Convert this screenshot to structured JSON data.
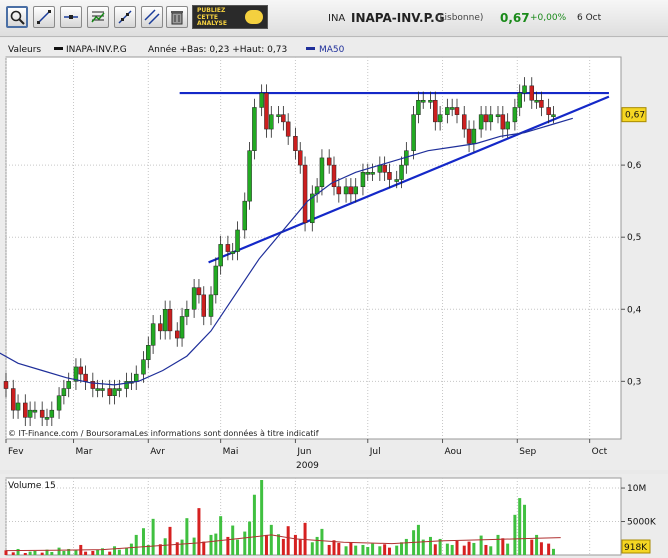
{
  "header": {
    "ad": {
      "lines": [
        "PUBLIEZ",
        "CETTE",
        "ANALYSE"
      ]
    },
    "symbol_code": "INA",
    "symbol_name": "INAPA-INV.P.G",
    "market": "(Lisbonne)",
    "price": "0,67",
    "change": "+0,00%",
    "date": "6 Oct",
    "tools": [
      "zoom-icon",
      "draw-line-icon",
      "horizontal-line-icon",
      "indicator-icon",
      "trend-line-icon",
      "parallel-lines-icon",
      "trash-icon"
    ]
  },
  "colors": {
    "up": "#22aa22",
    "down": "#cc1f1f",
    "ma": "#1f2f9a",
    "trendline": "#1428c8",
    "grid": "#c6c6c6",
    "price_label_bg": "#f5d623",
    "vol_up": "#40c040",
    "vol_down": "#d62020",
    "vol_ma": "#b03030"
  },
  "chart_data": [
    {
      "type": "candlestick",
      "legend": {
        "series_label": "Valeurs",
        "symbol": "INAPA-INV.P.G",
        "year_range": "Année +Bas: 0,23 +Haut: 0,73",
        "ma_label": "MA50"
      },
      "ylim": [
        0.22,
        0.75
      ],
      "yticks": [
        {
          "v": 0.3,
          "label": "0,3"
        },
        {
          "v": 0.4,
          "label": "0,4"
        },
        {
          "v": 0.5,
          "label": "0,5"
        },
        {
          "v": 0.6,
          "label": "0,6"
        }
      ],
      "x_months": [
        {
          "label": "Fev",
          "day": 0
        },
        {
          "label": "Mar",
          "day": 28
        },
        {
          "label": "Avr",
          "day": 59
        },
        {
          "label": "Mai",
          "day": 89
        },
        {
          "label": "Jun",
          "day": 120
        },
        {
          "label": "Jul",
          "day": 150
        },
        {
          "label": "Aou",
          "day": 181
        },
        {
          "label": "Sep",
          "day": 212
        },
        {
          "label": "Oct",
          "day": 242
        }
      ],
      "x_day_range": [
        0,
        255
      ],
      "year_label": "2009",
      "last_price_label": "0,67",
      "last_price": 0.67,
      "source": "© IT-Finance.com / BoursoramaLes informations sont données à titre indicatif",
      "resistance_line": {
        "from": [
          72,
          0.7
        ],
        "to": [
          250,
          0.7
        ]
      },
      "support_line": {
        "from": [
          84,
          0.465
        ],
        "to": [
          250,
          0.695
        ]
      },
      "ma50": [
        [
          -3,
          0.34
        ],
        [
          5,
          0.325
        ],
        [
          15,
          0.315
        ],
        [
          25,
          0.305
        ],
        [
          35,
          0.298
        ],
        [
          45,
          0.295
        ],
        [
          55,
          0.3
        ],
        [
          65,
          0.315
        ],
        [
          75,
          0.335
        ],
        [
          85,
          0.37
        ],
        [
          95,
          0.42
        ],
        [
          105,
          0.47
        ],
        [
          115,
          0.51
        ],
        [
          125,
          0.55
        ],
        [
          135,
          0.575
        ],
        [
          145,
          0.59
        ],
        [
          155,
          0.6
        ],
        [
          165,
          0.61
        ],
        [
          175,
          0.62
        ],
        [
          185,
          0.625
        ],
        [
          195,
          0.63
        ],
        [
          205,
          0.64
        ],
        [
          215,
          0.645
        ],
        [
          225,
          0.655
        ],
        [
          235,
          0.665
        ]
      ],
      "closes": [
        [
          0,
          0.29
        ],
        [
          3,
          0.26
        ],
        [
          5,
          0.27
        ],
        [
          8,
          0.25
        ],
        [
          10,
          0.26
        ],
        [
          12,
          0.26
        ],
        [
          15,
          0.25
        ],
        [
          17,
          0.25
        ],
        [
          19,
          0.26
        ],
        [
          22,
          0.28
        ],
        [
          24,
          0.29
        ],
        [
          26,
          0.3
        ],
        [
          29,
          0.32
        ],
        [
          31,
          0.31
        ],
        [
          33,
          0.3
        ],
        [
          36,
          0.29
        ],
        [
          38,
          0.29
        ],
        [
          40,
          0.29
        ],
        [
          43,
          0.28
        ],
        [
          45,
          0.29
        ],
        [
          47,
          0.29
        ],
        [
          50,
          0.3
        ],
        [
          52,
          0.3
        ],
        [
          54,
          0.31
        ],
        [
          57,
          0.33
        ],
        [
          59,
          0.35
        ],
        [
          61,
          0.38
        ],
        [
          64,
          0.37
        ],
        [
          66,
          0.4
        ],
        [
          68,
          0.37
        ],
        [
          71,
          0.36
        ],
        [
          73,
          0.39
        ],
        [
          75,
          0.4
        ],
        [
          78,
          0.43
        ],
        [
          80,
          0.42
        ],
        [
          82,
          0.39
        ],
        [
          85,
          0.42
        ],
        [
          87,
          0.46
        ],
        [
          89,
          0.49
        ],
        [
          92,
          0.48
        ],
        [
          94,
          0.48
        ],
        [
          96,
          0.51
        ],
        [
          99,
          0.55
        ],
        [
          101,
          0.62
        ],
        [
          103,
          0.68
        ],
        [
          106,
          0.7
        ],
        [
          108,
          0.65
        ],
        [
          110,
          0.67
        ],
        [
          113,
          0.67
        ],
        [
          115,
          0.66
        ],
        [
          117,
          0.64
        ],
        [
          120,
          0.62
        ],
        [
          122,
          0.6
        ],
        [
          124,
          0.52
        ],
        [
          127,
          0.56
        ],
        [
          129,
          0.57
        ],
        [
          131,
          0.61
        ],
        [
          134,
          0.6
        ],
        [
          136,
          0.57
        ],
        [
          138,
          0.56
        ],
        [
          141,
          0.57
        ],
        [
          143,
          0.56
        ],
        [
          145,
          0.57
        ],
        [
          148,
          0.59
        ],
        [
          150,
          0.59
        ],
        [
          152,
          0.59
        ],
        [
          155,
          0.6
        ],
        [
          157,
          0.59
        ],
        [
          159,
          0.58
        ],
        [
          162,
          0.58
        ],
        [
          164,
          0.6
        ],
        [
          166,
          0.62
        ],
        [
          169,
          0.67
        ],
        [
          171,
          0.69
        ],
        [
          173,
          0.69
        ],
        [
          176,
          0.69
        ],
        [
          178,
          0.66
        ],
        [
          180,
          0.67
        ],
        [
          183,
          0.68
        ],
        [
          185,
          0.68
        ],
        [
          187,
          0.67
        ],
        [
          190,
          0.65
        ],
        [
          192,
          0.63
        ],
        [
          194,
          0.65
        ],
        [
          197,
          0.67
        ],
        [
          199,
          0.66
        ],
        [
          201,
          0.67
        ],
        [
          204,
          0.67
        ],
        [
          206,
          0.65
        ],
        [
          208,
          0.66
        ],
        [
          211,
          0.68
        ],
        [
          213,
          0.7
        ],
        [
          215,
          0.71
        ],
        [
          218,
          0.69
        ],
        [
          220,
          0.69
        ],
        [
          222,
          0.68
        ],
        [
          225,
          0.67
        ],
        [
          227,
          0.67
        ]
      ]
    },
    {
      "type": "bar",
      "title": "Volume 15",
      "yticks": [
        {
          "v": 10000000,
          "label": "10M"
        },
        {
          "v": 5000000,
          "label": "5000K"
        }
      ],
      "ylim": [
        0,
        11500000
      ],
      "current_label": "918K",
      "volume_ma": [
        [
          0,
          650000
        ],
        [
          20,
          700000
        ],
        [
          40,
          800000
        ],
        [
          60,
          1300000
        ],
        [
          80,
          1800000
        ],
        [
          100,
          2600000
        ],
        [
          110,
          3000000
        ],
        [
          120,
          2400000
        ],
        [
          140,
          1900000
        ],
        [
          160,
          1700000
        ],
        [
          180,
          2100000
        ],
        [
          200,
          2300000
        ],
        [
          220,
          2500000
        ],
        [
          230,
          2600000
        ]
      ],
      "volumes": [
        [
          0,
          700000
        ],
        [
          3,
          400000
        ],
        [
          5,
          900000
        ],
        [
          8,
          300000
        ],
        [
          10,
          500000
        ],
        [
          12,
          600000
        ],
        [
          15,
          350000
        ],
        [
          17,
          800000
        ],
        [
          19,
          450000
        ],
        [
          22,
          1100000
        ],
        [
          24,
          600000
        ],
        [
          26,
          900000
        ],
        [
          29,
          700000
        ],
        [
          31,
          1500000
        ],
        [
          33,
          500000
        ],
        [
          36,
          600000
        ],
        [
          38,
          800000
        ],
        [
          40,
          1000000
        ],
        [
          43,
          500000
        ],
        [
          45,
          1300000
        ],
        [
          47,
          800000
        ],
        [
          50,
          1100000
        ],
        [
          52,
          1700000
        ],
        [
          54,
          3000000
        ],
        [
          57,
          4000000
        ],
        [
          59,
          1500000
        ],
        [
          61,
          5400000
        ],
        [
          64,
          1600000
        ],
        [
          66,
          2500000
        ],
        [
          68,
          4200000
        ],
        [
          71,
          1900000
        ],
        [
          73,
          2300000
        ],
        [
          75,
          5500000
        ],
        [
          78,
          2600000
        ],
        [
          80,
          7000000
        ],
        [
          82,
          2000000
        ],
        [
          85,
          3000000
        ],
        [
          87,
          3200000
        ],
        [
          89,
          5800000
        ],
        [
          92,
          2700000
        ],
        [
          94,
          4400000
        ],
        [
          96,
          2300000
        ],
        [
          99,
          3500000
        ],
        [
          101,
          5000000
        ],
        [
          103,
          9000000
        ],
        [
          106,
          11200000
        ],
        [
          108,
          3000000
        ],
        [
          110,
          4500000
        ],
        [
          113,
          3100000
        ],
        [
          115,
          2400000
        ],
        [
          117,
          4300000
        ],
        [
          120,
          3000000
        ],
        [
          122,
          2300000
        ],
        [
          124,
          4800000
        ],
        [
          127,
          1900000
        ],
        [
          129,
          2700000
        ],
        [
          131,
          3900000
        ],
        [
          134,
          1500000
        ],
        [
          136,
          2200000
        ],
        [
          138,
          1800000
        ],
        [
          141,
          1300000
        ],
        [
          143,
          1900000
        ],
        [
          145,
          1400000
        ],
        [
          148,
          1500000
        ],
        [
          150,
          1200000
        ],
        [
          152,
          1700000
        ],
        [
          155,
          1300000
        ],
        [
          157,
          1600000
        ],
        [
          159,
          1100000
        ],
        [
          162,
          1400000
        ],
        [
          164,
          1900000
        ],
        [
          166,
          2400000
        ],
        [
          169,
          3700000
        ],
        [
          171,
          4500000
        ],
        [
          173,
          2300000
        ],
        [
          176,
          2700000
        ],
        [
          178,
          1600000
        ],
        [
          180,
          2400000
        ],
        [
          183,
          1700000
        ],
        [
          185,
          1500000
        ],
        [
          187,
          2100000
        ],
        [
          190,
          1400000
        ],
        [
          192,
          2000000
        ],
        [
          194,
          1800000
        ],
        [
          197,
          2900000
        ],
        [
          199,
          1500000
        ],
        [
          201,
          1300000
        ],
        [
          204,
          3000000
        ],
        [
          206,
          2500000
        ],
        [
          208,
          1700000
        ],
        [
          211,
          6000000
        ],
        [
          213,
          8500000
        ],
        [
          215,
          7500000
        ],
        [
          218,
          2300000
        ],
        [
          220,
          3000000
        ],
        [
          222,
          1900000
        ],
        [
          225,
          1700000
        ],
        [
          227,
          918000
        ]
      ]
    }
  ]
}
